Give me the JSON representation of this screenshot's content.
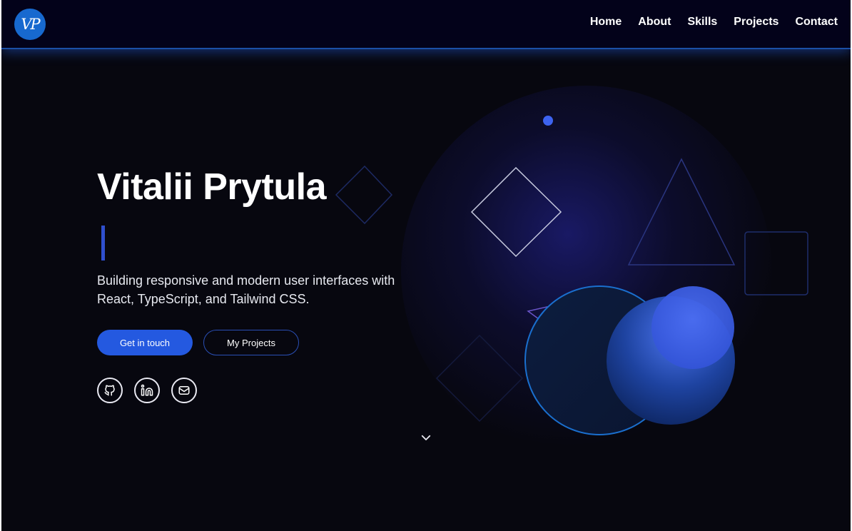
{
  "navbar": {
    "logo_text": "VP",
    "links": [
      {
        "label": "Home"
      },
      {
        "label": "About"
      },
      {
        "label": "Skills"
      },
      {
        "label": "Projects"
      },
      {
        "label": "Contact"
      }
    ]
  },
  "hero": {
    "title": "Vitalii Prytula",
    "description": "Building responsive and modern user interfaces with React, TypeScript, and Tailwind CSS.",
    "primary_button": "Get in touch",
    "secondary_button": "My Projects",
    "social_icons": [
      "github-icon",
      "linkedin-icon",
      "mail-icon"
    ],
    "scroll_icon": "chevron-down-icon"
  },
  "colors": {
    "background": "#07070f",
    "navbar": "#03021a",
    "accent": "#2459e0",
    "logo": "#1769cf"
  }
}
